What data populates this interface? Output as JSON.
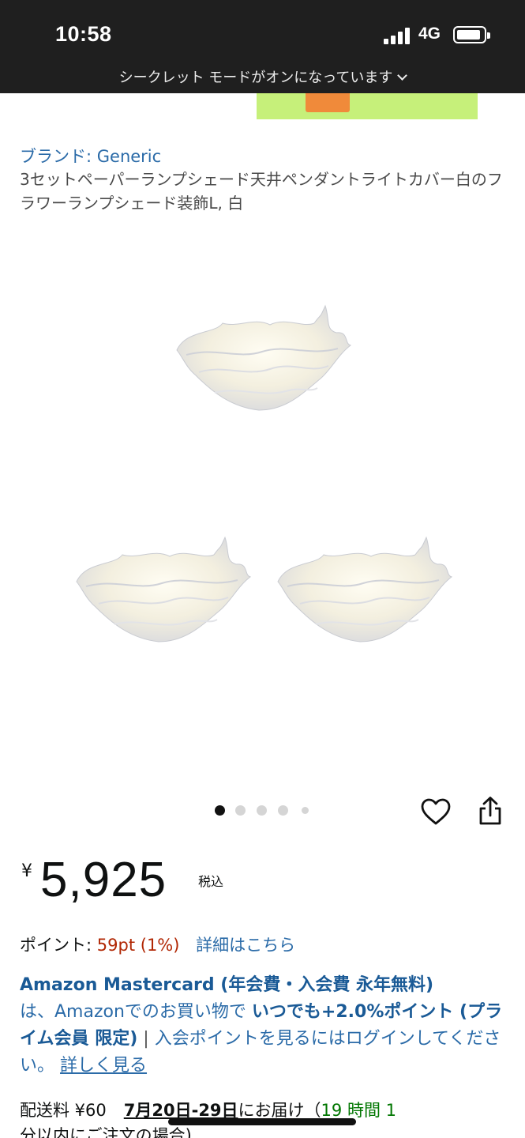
{
  "status_bar": {
    "time": "10:58",
    "network": "4G",
    "incognito_notice": "シークレット モードがオンになっています"
  },
  "product": {
    "brand": "ブランド: Generic",
    "title": "3セットペーパーランプシェード天井ペンダントライトカバー白のフラワーランプシェード装飾L, 白"
  },
  "carousel": {
    "total_images": 5,
    "active_index": 0
  },
  "price": {
    "currency_symbol": "¥",
    "amount": "5,925",
    "tax_label": "税込"
  },
  "points": {
    "label": "ポイント:",
    "value": "59pt",
    "percent": "(1%)",
    "details_link": "詳細はこちら"
  },
  "card_promo": {
    "title": "Amazon Mastercard (年会費・入会費 永年無料)",
    "text1": "は、Amazonでのお買い物で",
    "highlight": "いつでも+2.0%ポイント (プライム会員 限定)",
    "separator": "|",
    "text2": "入会ポイントを見るにはログインしてください。",
    "link": "詳しく見る"
  },
  "shipping": {
    "label": "配送料 ¥60",
    "date": "7月20日-29日",
    "suffix": "にお届け（",
    "countdown": "19 時間 1",
    "line2": "分以内にご注文の場合)"
  },
  "colors": {
    "link": "#2b6ba8",
    "price_points": "#b12704",
    "status_bar_bg": "#1f1f1f"
  },
  "icons": {
    "heart": "heart-icon",
    "share": "share-icon"
  }
}
